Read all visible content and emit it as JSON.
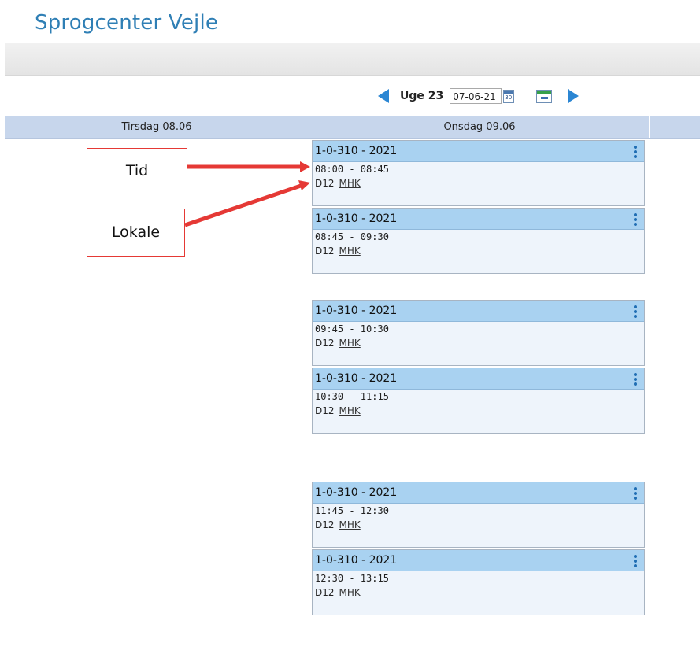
{
  "site_title": "Sprogcenter Vejle",
  "week_nav": {
    "week_label": "Uge 23",
    "date_value": "07-06-21",
    "calendar_icon_text": "30"
  },
  "day_headers": [
    "Tirsdag 08.06",
    "Onsdag 09.06"
  ],
  "annotations": {
    "tid": "Tid",
    "lokale": "Lokale",
    "color": "#e53935"
  },
  "lessons": [
    {
      "title": "1-0-310 - 2021",
      "time": "08:00 - 08:45",
      "room": "D12",
      "teacher": "MHK"
    },
    {
      "title": "1-0-310 - 2021",
      "time": "08:45 - 09:30",
      "room": "D12",
      "teacher": "MHK"
    },
    {
      "title": "1-0-310 - 2021",
      "time": "09:45 - 10:30",
      "room": "D12",
      "teacher": "MHK"
    },
    {
      "title": "1-0-310 - 2021",
      "time": "10:30 - 11:15",
      "room": "D12",
      "teacher": "MHK"
    },
    {
      "title": "1-0-310 - 2021",
      "time": "11:45 - 12:30",
      "room": "D12",
      "teacher": "MHK"
    },
    {
      "title": "1-0-310 - 2021",
      "time": "12:30 - 13:15",
      "room": "D12",
      "teacher": "MHK"
    }
  ],
  "colors": {
    "title_blue": "#2f7fb5",
    "nav_arrow": "#2b86d3",
    "day_header_bg": "#c7d6ec",
    "lesson_header_bg": "#a9d2f1",
    "lesson_body_bg": "#eef4fb"
  }
}
